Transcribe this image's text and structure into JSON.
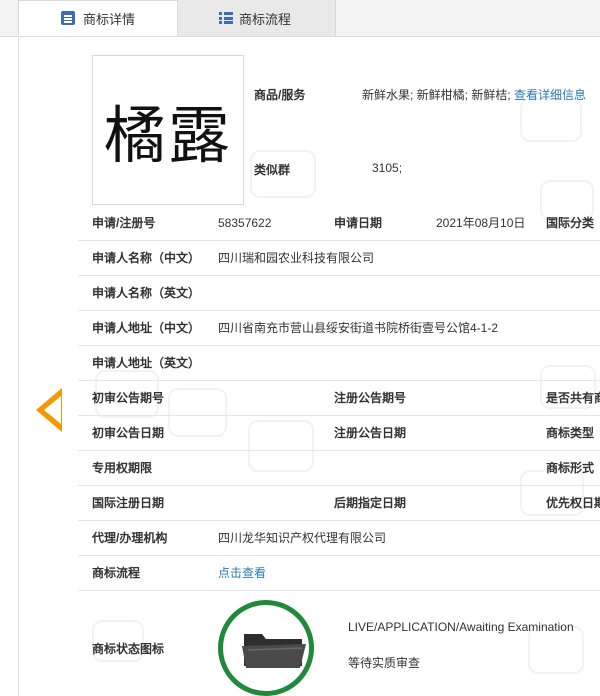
{
  "tabs": [
    {
      "label": "商标详情",
      "icon": "document-list-icon",
      "active": true
    },
    {
      "label": "商标流程",
      "icon": "list-icon",
      "active": false
    }
  ],
  "trademark": {
    "mark_text": "橘露",
    "goods_services_label": "商品/服务",
    "goods_services_value": "新鲜水果; 新鲜柑橘; 新鲜桔;",
    "detail_link": "查看详细信息",
    "similar_group_label": "类似群",
    "similar_group_value": "3105;"
  },
  "rows": {
    "reg_no": {
      "label": "申请/注册号",
      "value": "58357622"
    },
    "app_date": {
      "label": "申请日期",
      "value": "2021年08月10日"
    },
    "intl_class": {
      "label": "国际分类"
    },
    "applicant_cn": {
      "label": "申请人名称（中文）",
      "value": "四川瑞和园农业科技有限公司"
    },
    "applicant_en": {
      "label": "申请人名称（英文）"
    },
    "address_cn": {
      "label": "申请人地址（中文）",
      "value": "四川省南充市营山县绥安街道书院桥街壹号公馆4-1-2"
    },
    "address_en": {
      "label": "申请人地址（英文）"
    },
    "prelim_pub_no": {
      "label": "初审公告期号"
    },
    "reg_pub_no": {
      "label": "注册公告期号"
    },
    "shared": {
      "label": "是否共有商"
    },
    "prelim_pub_date": {
      "label": "初审公告日期"
    },
    "reg_pub_date": {
      "label": "注册公告日期"
    },
    "mark_type": {
      "label": "商标类型"
    },
    "exclusive_term": {
      "label": "专用权期限"
    },
    "mark_form": {
      "label": "商标形式"
    },
    "intl_reg_date": {
      "label": "国际注册日期"
    },
    "later_designation": {
      "label": "后期指定日期"
    },
    "priority_date": {
      "label": "优先权日期"
    },
    "agent": {
      "label": "代理/办理机构",
      "value": "四川龙华知识产权代理有限公司"
    },
    "process": {
      "label": "商标流程",
      "value": "点击查看"
    }
  },
  "status": {
    "label": "商标状态图标",
    "status_en": "LIVE/APPLICATION/Awaiting Examination",
    "status_cn": "等待实质审查",
    "icon": "folder-icon",
    "ring_color": "#1e8a3a"
  },
  "colors": {
    "accent_blue": "#3d6db5",
    "link": "#2a7ab0",
    "arrow": "#f39800"
  }
}
